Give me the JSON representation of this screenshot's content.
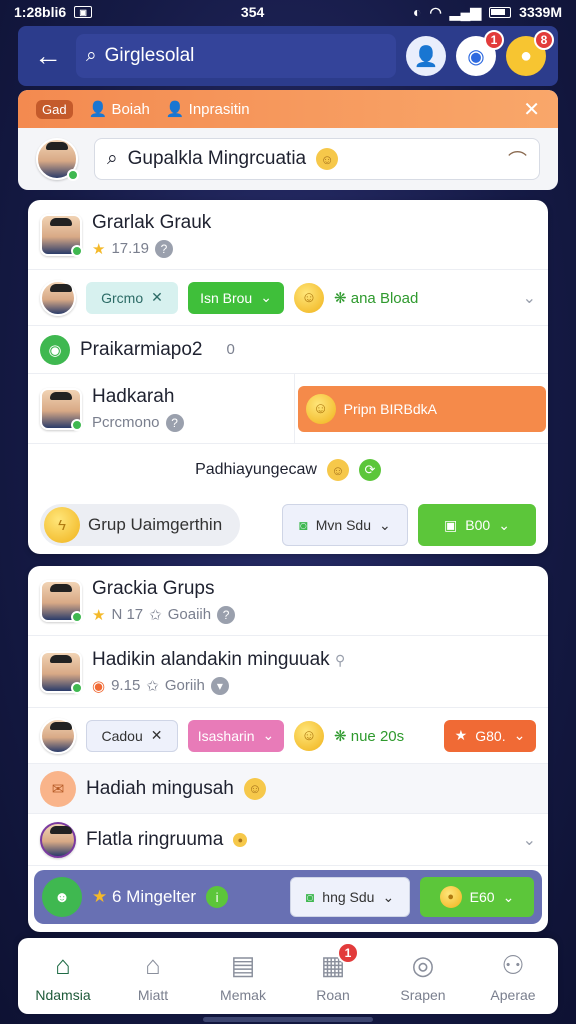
{
  "status": {
    "time": "1:28bli6",
    "center": "354",
    "battery": "3339M"
  },
  "topbar": {
    "search_text": "Girglesolal",
    "chat_badge": "1",
    "coin_badge": "8"
  },
  "panel": {
    "tag": "Gad",
    "tab1": "Boiah",
    "tab2": "Inprasitin",
    "search_text": "Gupalkla Mingrcuatia"
  },
  "card1": {
    "r1_title": "Grarlak Grauk",
    "r1_sub": "17.19",
    "r2_pill1": "Grcmo",
    "r2_pill2": "Isn Brou",
    "r2_text": "ana Bload",
    "r3_title": "Praikarmiapo2",
    "r3_mark": "0",
    "r4_title": "Hadkarah",
    "r4_sub": "Pcrcmono",
    "r4_pill": "Pripn BIRBdkA",
    "r5_text": "Padhiayungecaw",
    "r6_btn": "Grup Uaimgerthin",
    "r6_pill1": "Mvn Sdu",
    "r6_pill2": "B00"
  },
  "card2": {
    "r1_title": "Grackia Grups",
    "r1_sub_a": "N 17",
    "r1_sub_b": "Goaiih",
    "r2_title": "Hadikin alandakin minguuak",
    "r2_sub_a": "9.15",
    "r2_sub_b": "Goriih",
    "r3_pill1": "Cadou",
    "r3_pill2": "Isasharin",
    "r3_text": "nue 20s",
    "r3_pill3": "G80.",
    "r4_title": "Hadiah mingusah",
    "r5_title": "Flatla ringruuma",
    "r6_text": "6 Mingelter",
    "r6_pill1": "hng Sdu",
    "r6_pill2": "E60"
  },
  "nav": {
    "items": [
      {
        "label": "Ndamsia"
      },
      {
        "label": "Miatt"
      },
      {
        "label": "Memak"
      },
      {
        "label": "Roan"
      },
      {
        "label": "Srapen"
      },
      {
        "label": "Aperae"
      }
    ],
    "badge": "1"
  }
}
